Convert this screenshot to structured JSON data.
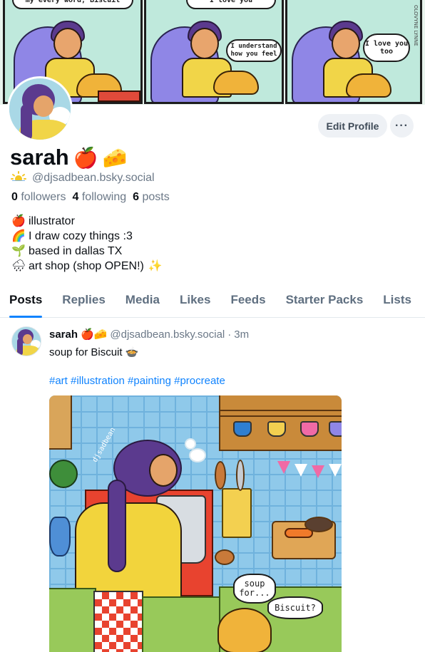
{
  "banner": {
    "panel1_text": "my every word, Biscuit",
    "panel2_top_text": "I love you",
    "panel2_bubble": "I understand how you feel",
    "panel3_bubble": "I love you too",
    "signature": "OLOVYNE LYNNE"
  },
  "profile": {
    "display_name": "sarah",
    "name_emojis": [
      "🍎",
      "🧀"
    ],
    "handle_icon": "sun-icon",
    "handle": "@djsadbean.bsky.social",
    "followers_count": "0",
    "followers_label": "followers",
    "following_count": "4",
    "following_label": "following",
    "posts_count": "6",
    "posts_label": "posts",
    "bio": [
      {
        "emoji": "🍎",
        "text": "illustrator"
      },
      {
        "emoji": "🌈",
        "text": "I draw cozy things :3"
      },
      {
        "emoji": "🌱",
        "text": "based in dallas TX"
      },
      {
        "emoji": "🌧",
        "text": "art shop (shop OPEN!)",
        "trail": "✨"
      }
    ],
    "edit_profile_label": "Edit Profile",
    "more_label": "···"
  },
  "tabs": [
    {
      "label": "Posts",
      "active": true
    },
    {
      "label": "Replies",
      "active": false
    },
    {
      "label": "Media",
      "active": false
    },
    {
      "label": "Likes",
      "active": false
    },
    {
      "label": "Feeds",
      "active": false
    },
    {
      "label": "Starter Packs",
      "active": false
    },
    {
      "label": "Lists",
      "active": false
    }
  ],
  "post": {
    "author_name": "sarah",
    "author_emojis": "🍎🧀",
    "author_handle": "@djsadbean.bsky.social",
    "separator": "·",
    "time": "3m",
    "text": "soup for Biscuit 🍲",
    "hashtags": "#art #illustration #painting #procreate",
    "image": {
      "bubble_1": "soup for...",
      "bubble_2": "Biscuit?",
      "watermark": "djsadbean"
    }
  },
  "colors": {
    "accent": "#1083fe",
    "muted_text": "#6b7887",
    "button_bg": "#eef1f5"
  }
}
